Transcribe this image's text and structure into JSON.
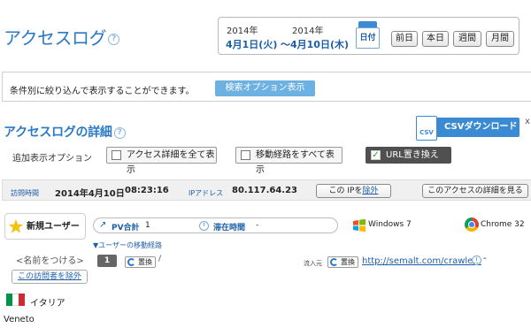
{
  "header": {
    "title": "アクセスログ",
    "help_icon": "?",
    "date_from_year": "2014年",
    "date_from_day": "4月1日(火)",
    "date_to_year": "2014年",
    "date_to_day": "〜4月10日(木)",
    "calendar_label": "日付",
    "range_buttons": [
      "前日",
      "本日",
      "週間",
      "月間"
    ]
  },
  "filter": {
    "text": "条件別に絞り込んで表示することができます。",
    "search_option_button": "検索オプション表示"
  },
  "detail": {
    "title": "アクセスログの詳細",
    "help_icon": "?",
    "csv_button": "CSVダウンロード",
    "csv_icon_text": "CSV",
    "close_label": "x",
    "options_label": "追加表示オプション",
    "options": [
      {
        "label": "アクセス詳細を全て表示",
        "checked": false
      },
      {
        "label": "移動経路をすべて表示",
        "checked": false
      },
      {
        "label": "URL置き換え",
        "checked": true
      }
    ],
    "check_mark": "✓"
  },
  "visit": {
    "time_label": "訪問時間",
    "date": "2014年4月10日",
    "time": "08:23:16",
    "ip_label": "IPアドレス",
    "ip": "80.117.64.23",
    "ip_button_prefix": "この IPを",
    "ip_button_link": "除外",
    "detail_button": "このアクセスの詳細を見る",
    "user_type": "新規ユーザー",
    "name_link": "<名前をつける>",
    "exclude_visitor_button": "この訪問者を除外",
    "pv_label": "PV合計",
    "pv_value": "1",
    "stay_label": "滞在時間",
    "stay_value": "-",
    "os": "Windows 7",
    "browser": "Chrome 32",
    "route_title": "▼ユーザーの移動経路",
    "step_number": "1",
    "replace_label": "置換",
    "step_path": "/",
    "referrer_label": "流入元",
    "referrer_url": "http://semalt.com/crawle...",
    "referrer_time": "-",
    "country": "イタリア",
    "region": "Veneto",
    "flag_colors": [
      "#009246",
      "#ffffff",
      "#ce2b37"
    ]
  }
}
